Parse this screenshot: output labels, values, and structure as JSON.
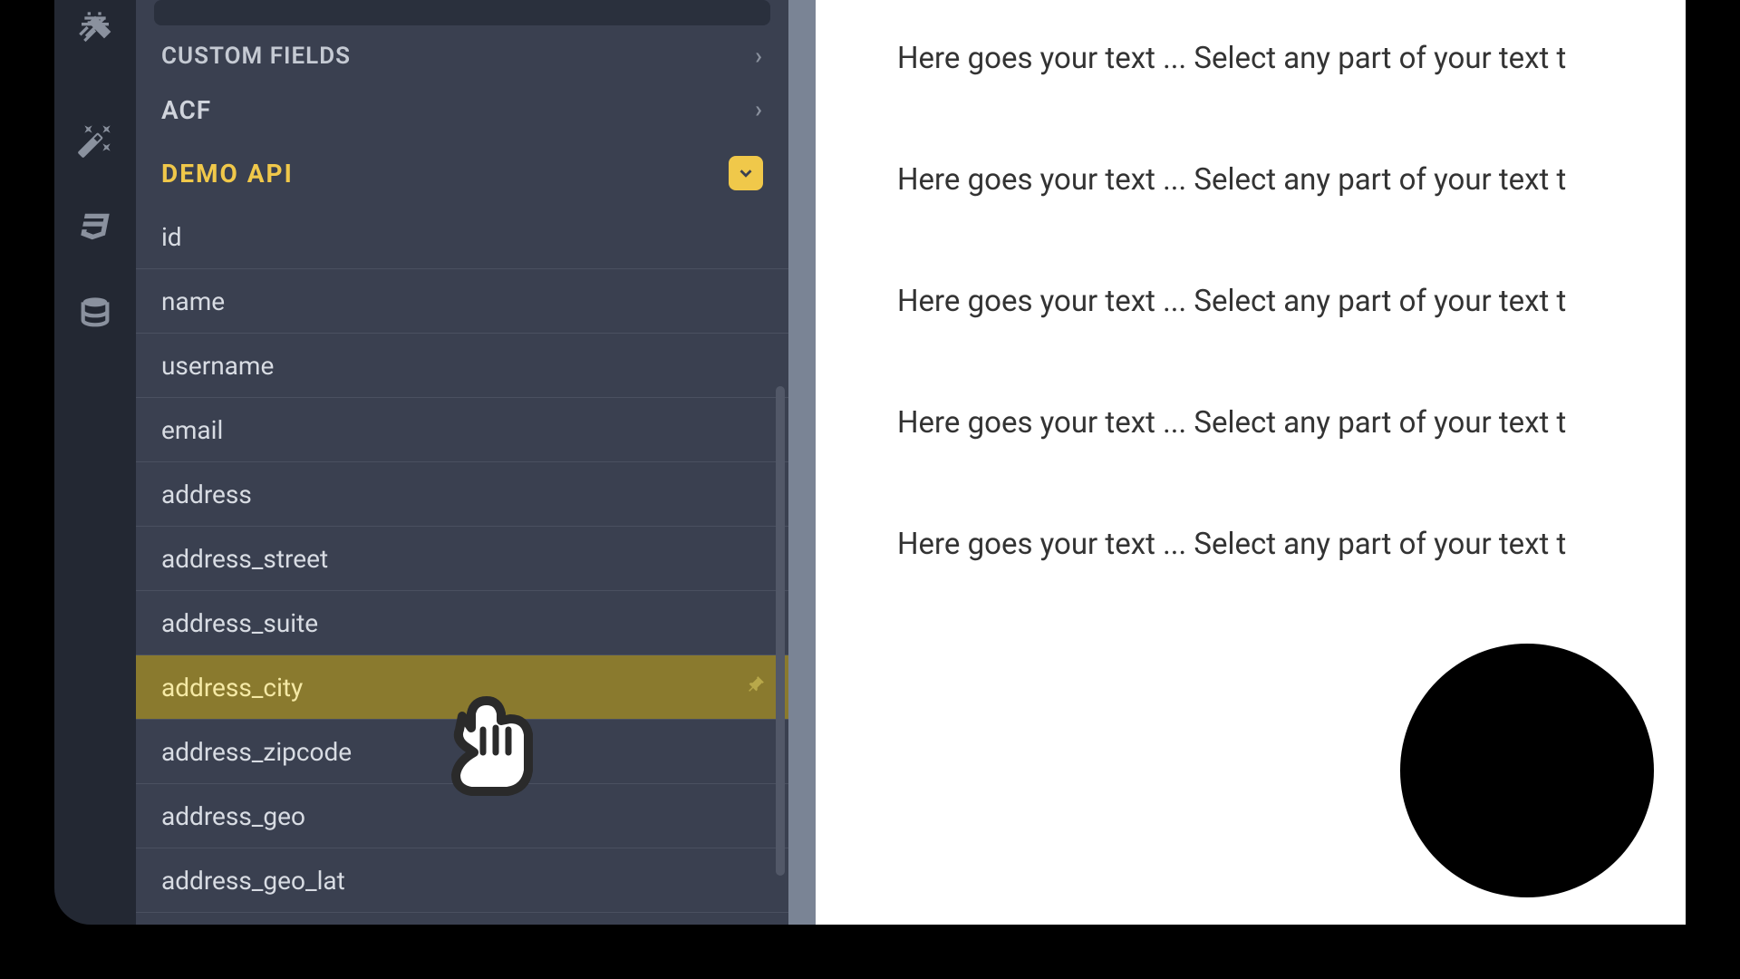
{
  "sections": {
    "custom_fields": "CUSTOM FIELDS",
    "acf": "ACF",
    "demo_api": "DEMO API"
  },
  "fields": [
    {
      "label": "id",
      "highlighted": false
    },
    {
      "label": "name",
      "highlighted": false
    },
    {
      "label": "username",
      "highlighted": false
    },
    {
      "label": "email",
      "highlighted": false
    },
    {
      "label": "address",
      "highlighted": false
    },
    {
      "label": "address_street",
      "highlighted": false
    },
    {
      "label": "address_suite",
      "highlighted": false
    },
    {
      "label": "address_city",
      "highlighted": true
    },
    {
      "label": "address_zipcode",
      "highlighted": false
    },
    {
      "label": "address_geo",
      "highlighted": false
    },
    {
      "label": "address_geo_lat",
      "highlighted": false
    }
  ],
  "preview": {
    "placeholder": "Here goes your text ... Select any part of your text t"
  }
}
